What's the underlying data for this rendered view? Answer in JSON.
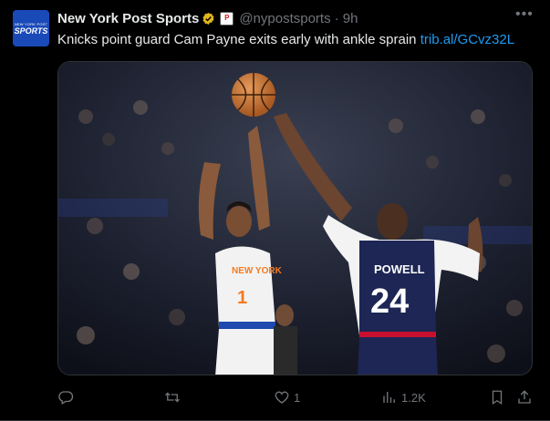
{
  "account": {
    "name": "New York Post Sports",
    "handle": "@nypostsports",
    "time": "· 9h",
    "avatar_small_text": "NEW YORK POST",
    "avatar_big_text": "SPORTS"
  },
  "tweet": {
    "text": "Knicks point guard Cam Payne exits early with ankle sprain ",
    "link": "trib.al/GCvz32L"
  },
  "media": {
    "left_jersey_name": "NEW YORK",
    "left_jersey_number": "1",
    "right_jersey_name": "POWELL",
    "right_jersey_number": "24"
  },
  "actions": {
    "reply_count": "",
    "retweet_count": "",
    "like_count": "1",
    "views_count": "1.2K"
  },
  "colors": {
    "background": "#000000",
    "text": "#e7e9ea",
    "muted": "#71767b",
    "link": "#1d9bf0",
    "verified_gold": "#e2b719",
    "avatar_blue": "#1a49b8"
  },
  "icons": [
    "verified-badge-icon",
    "affiliate-badge-icon",
    "more-icon",
    "reply-icon",
    "retweet-icon",
    "like-icon",
    "views-icon",
    "bookmark-icon",
    "share-icon"
  ]
}
